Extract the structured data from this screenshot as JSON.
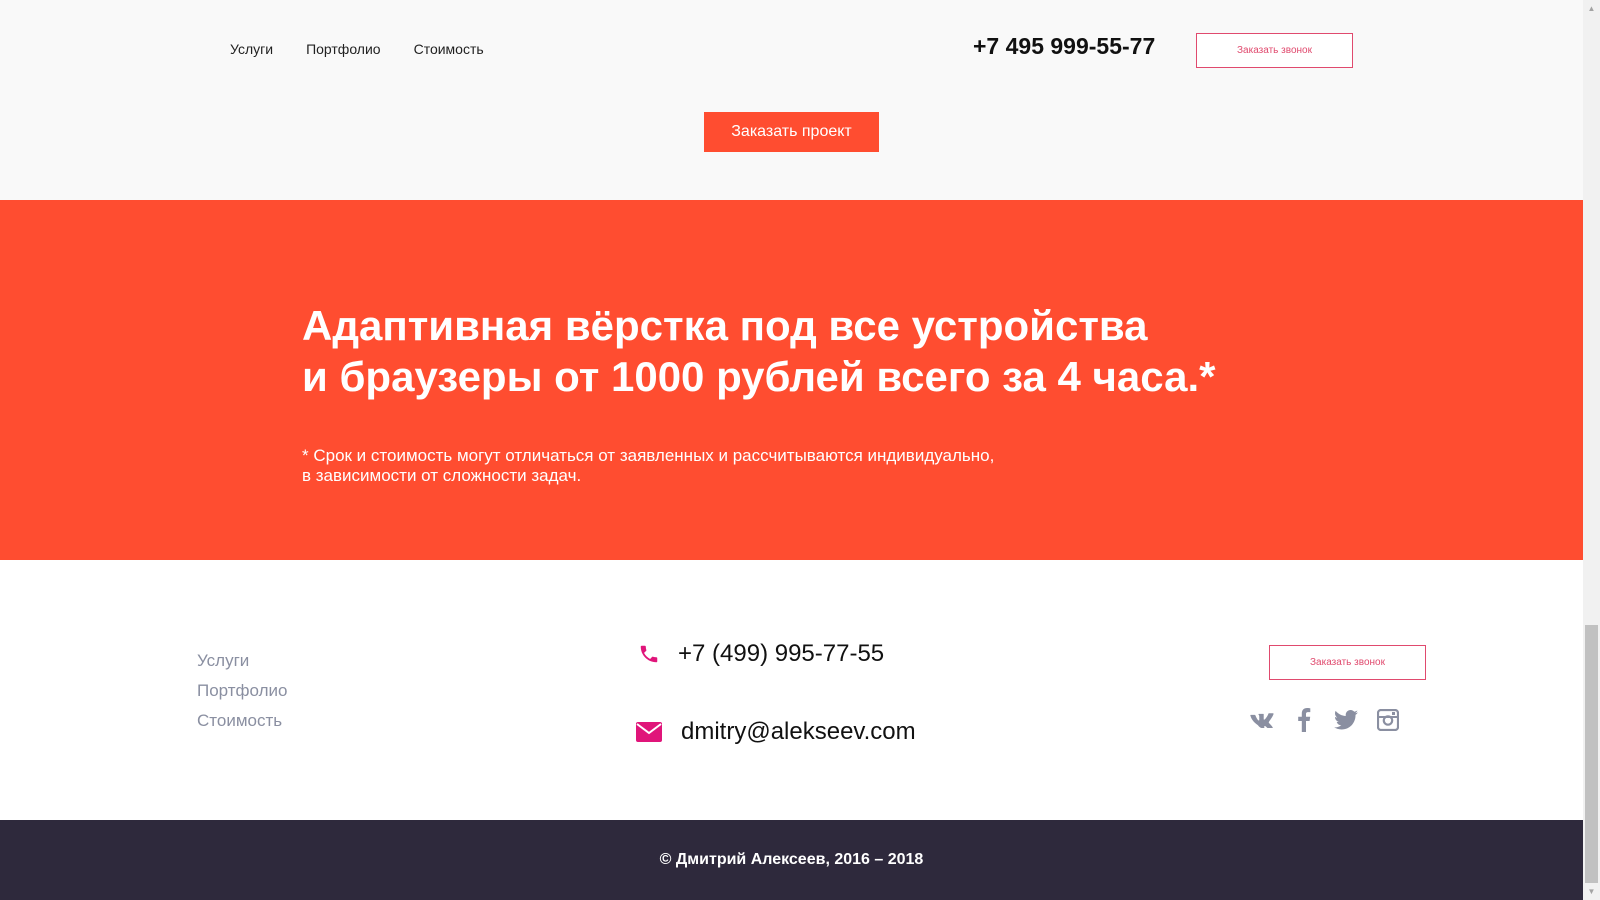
{
  "header": {
    "nav": [
      "Услуги",
      "Портфолио",
      "Стоимость"
    ],
    "phone": "+7 495 999-55-77",
    "callback_label": "Заказать звонок",
    "order_label": "Заказать проект"
  },
  "promo": {
    "title_line1": "Адаптивная вёрстка под все устройства",
    "title_line2": "и браузеры от 1000 рублей всего за 4 часа.*",
    "note_line1": "* Срок и стоимость могут отличаться от заявленных и рассчитываются индивидуально,",
    "note_line2": "в зависимости от сложности задач."
  },
  "footer": {
    "nav": [
      "Услуги",
      "Портфолио",
      "Стоимость"
    ],
    "phone": "+7 (499) 995-77-55",
    "email": "dmitry@alekseev.com",
    "callback_label": "Заказать звонок",
    "socials": [
      "vk-icon",
      "facebook-icon",
      "twitter-icon",
      "instagram-icon"
    ],
    "copyright": "© Дмитрий Алексеев, 2016 – 2018"
  },
  "colors": {
    "accent": "#ff4d30",
    "pink": "#e0157a",
    "dark": "#2e293c",
    "muted": "#8a8fa1"
  }
}
